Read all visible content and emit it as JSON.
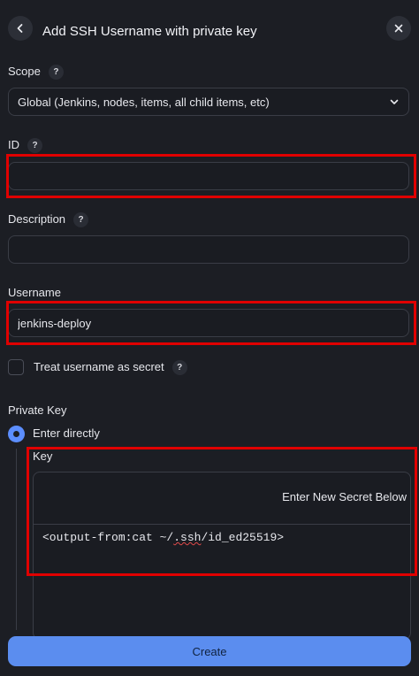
{
  "header": {
    "title": "Add SSH Username with private key",
    "back_icon": "chevron-left-icon",
    "close_icon": "close-icon"
  },
  "scope": {
    "label": "Scope",
    "help": "?",
    "value": "Global (Jenkins, nodes, items, all child items, etc)"
  },
  "id_field": {
    "label": "ID",
    "help": "?",
    "value": ""
  },
  "description": {
    "label": "Description",
    "help": "?",
    "value": ""
  },
  "username": {
    "label": "Username",
    "value": "jenkins-deploy"
  },
  "treat_secret": {
    "label": "Treat username as secret",
    "help": "?",
    "checked": false
  },
  "private_key": {
    "label": "Private Key",
    "option_label": "Enter directly",
    "key_label": "Key",
    "secret_hint": "Enter New Secret Below",
    "key_value_prefix": "<output-from:cat ~/",
    "key_value_squiggle": ".ssh",
    "key_value_suffix": "/id_ed25519>"
  },
  "create_button": {
    "label": "Create"
  },
  "colors": {
    "accent": "#5b8def",
    "highlight": "#e00000",
    "background": "#1c1e24"
  }
}
